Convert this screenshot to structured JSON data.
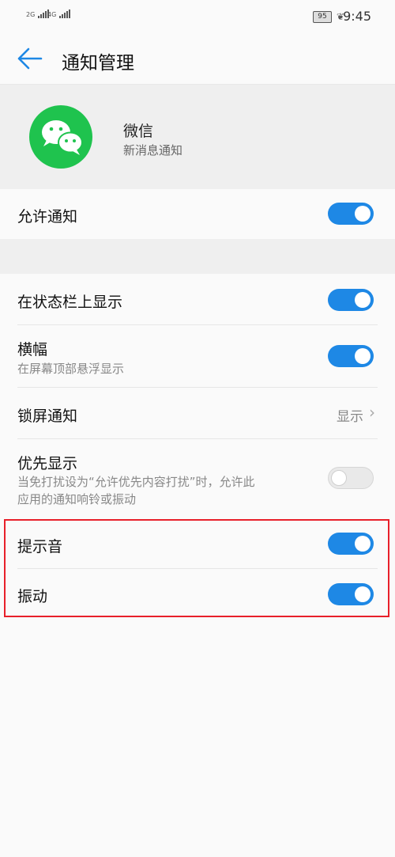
{
  "status_bar": {
    "signal1_label": "2G",
    "signal2_label": "4G",
    "battery": "95",
    "time": "9:45"
  },
  "app_bar": {
    "title": "通知管理"
  },
  "app_info": {
    "name": "微信",
    "subtitle": "新消息通知",
    "icon": "wechat-icon"
  },
  "settings": {
    "allow": {
      "label": "允许通知",
      "on": true
    },
    "status_bar_display": {
      "label": "在状态栏上显示",
      "on": true
    },
    "banner": {
      "label": "横幅",
      "desc": "在屏幕顶部悬浮显示",
      "on": true
    },
    "lock_screen": {
      "label": "锁屏通知",
      "value": "显示"
    },
    "priority": {
      "label": "优先显示",
      "desc1": "当免打扰设为“允许优先内容打扰”时，允许此",
      "desc2": "应用的通知响铃或振动",
      "on": false
    },
    "sound": {
      "label": "提示音",
      "on": true
    },
    "vibrate": {
      "label": "振动",
      "on": true
    }
  },
  "colors": {
    "accent": "#1e88e5",
    "wechat_green": "#1fc34e",
    "highlight": "#e8202a"
  }
}
